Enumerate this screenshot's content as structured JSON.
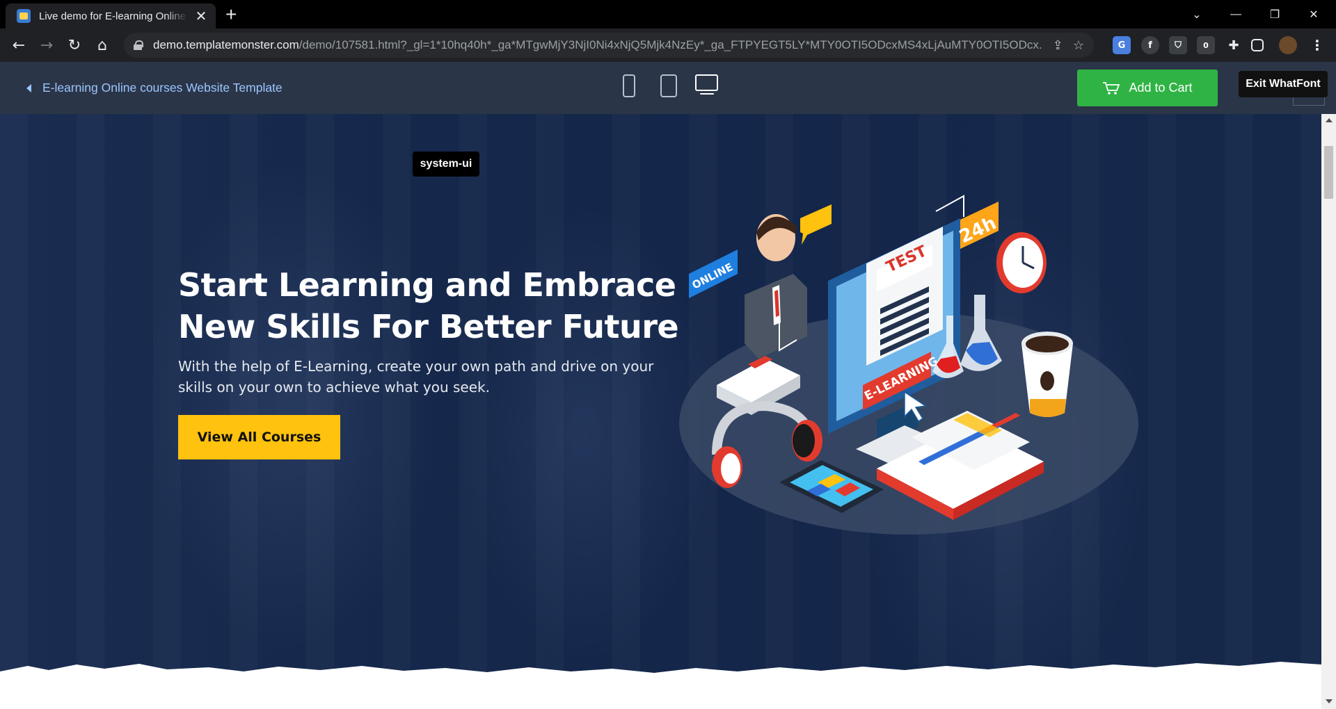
{
  "browser": {
    "tab_title": "Live demo for E-learning Online courses Website Template",
    "new_tab": "+",
    "tab_close": "✕",
    "url_host": "demo.templatemonster.com",
    "url_path": "/demo/107581.html?_gl=1*10hq40h*_ga*MTgwMjY3NjI0Ni4xNjQ5Mjk4NzEy*_ga_FTPYEGT5LY*MTY0OTI5ODcxMS4xLjAuMTY0OTI5ODcx...",
    "extension_badge": "0"
  },
  "demo_bar": {
    "back_label": "E-learning Online courses Website Template",
    "cart_label": "Add to Cart",
    "exit_whatfont": "Exit WhatFont"
  },
  "hero": {
    "whatfont_tooltip": "system-ui",
    "title_line1": "Start Learning and Embrace",
    "title_line2": "New Skills For Better Future",
    "subtitle_line1": "With the help of E-Learning, create your own path and drive on your",
    "subtitle_line2": "skills on your own to achieve what you seek.",
    "cta_label": "View All Courses"
  },
  "illustration": {
    "badge_online": "ONLINE",
    "badge_24h": "24h",
    "screen_test": "TEST",
    "banner_elearning": "E-LEARNING"
  },
  "colors": {
    "hero_bg": "#15284b",
    "cta": "#ffc20e",
    "cart": "#2fb344",
    "link": "#9cc6ff"
  }
}
